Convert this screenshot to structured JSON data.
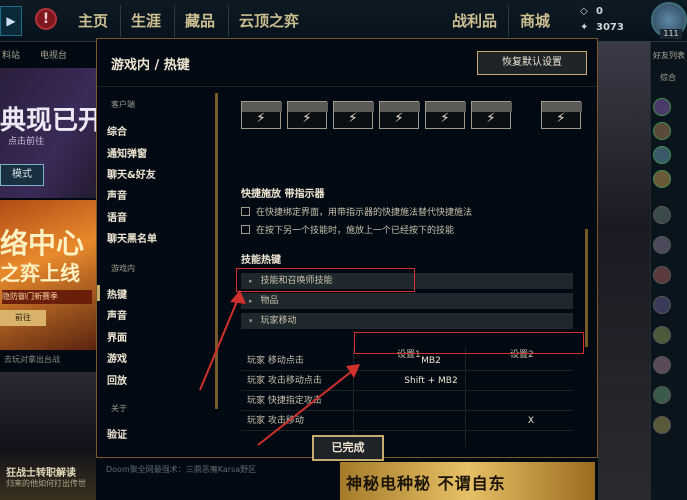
{
  "topbar": {
    "nav": [
      "主页",
      "生涯",
      "藏品",
      "云顶之弈",
      "战利品",
      "商城"
    ],
    "currency_top": "0",
    "currency_bottom": "3073",
    "level": "111"
  },
  "background": {
    "subnav": [
      "料站",
      "电视台"
    ],
    "hero_title": "典现已开",
    "hero_sub": "点击前往",
    "hero_btn": "模式",
    "promo_t1": "络中心",
    "promo_t2": "之弈上线",
    "promo_b": "隐防御门新赛季",
    "promo_btn": "前往",
    "news": "去玩对拿出台战",
    "tile_t1": "狂战士转职解读",
    "tile_t2": "归来的他如何打出传世",
    "ticker": "Doom聚全网最强术：三鼎恶魔Karsa野区",
    "banner": "神秘电种秘 不谓自东",
    "friends_title": "好友列表",
    "friends_group": "综合"
  },
  "dialog": {
    "title": "游戏内 / 热键",
    "restore_label": "恢复默认设置",
    "done_label": "已完成",
    "sidebar": {
      "cat1": "客户端",
      "items1": [
        "综合",
        "通知弹窗",
        "聊天&好友",
        "声音",
        "语音",
        "聊天黑名单"
      ],
      "cat2": "游戏内",
      "items2": [
        "热键",
        "声音",
        "界面",
        "游戏",
        "回放"
      ],
      "cat3": "关于",
      "items3": [
        "验证"
      ]
    },
    "keys": [
      "⚡",
      "⚡",
      "⚡",
      "⚡",
      "⚡",
      "⚡",
      "⚡"
    ],
    "quickcast": {
      "title": "快捷施放 带指示器",
      "opt1": "在快捷绑定界面，用带指示器的快捷施法替代快捷施法",
      "opt2": "在按下另一个技能时，施放上一个已经按下的技能"
    },
    "hotkeys": {
      "title": "技能热键",
      "groups": [
        "技能和召唤师技能",
        "物品",
        "玩家移动"
      ],
      "col1": "设置1",
      "col2": "设置2",
      "rows": [
        {
          "label": "玩家 移动点击",
          "v1": "MB2",
          "v2": ""
        },
        {
          "label": "玩家 攻击移动点击",
          "v1": "Shift + MB2",
          "v2": ""
        },
        {
          "label": "玩家 快捷指定攻击",
          "v1": "",
          "v2": ""
        },
        {
          "label": "玩家 攻击移动",
          "v1": "",
          "v2": "X"
        }
      ]
    }
  },
  "colors": {
    "accent": "#c8aa6e",
    "annotation": "#d0312d"
  }
}
